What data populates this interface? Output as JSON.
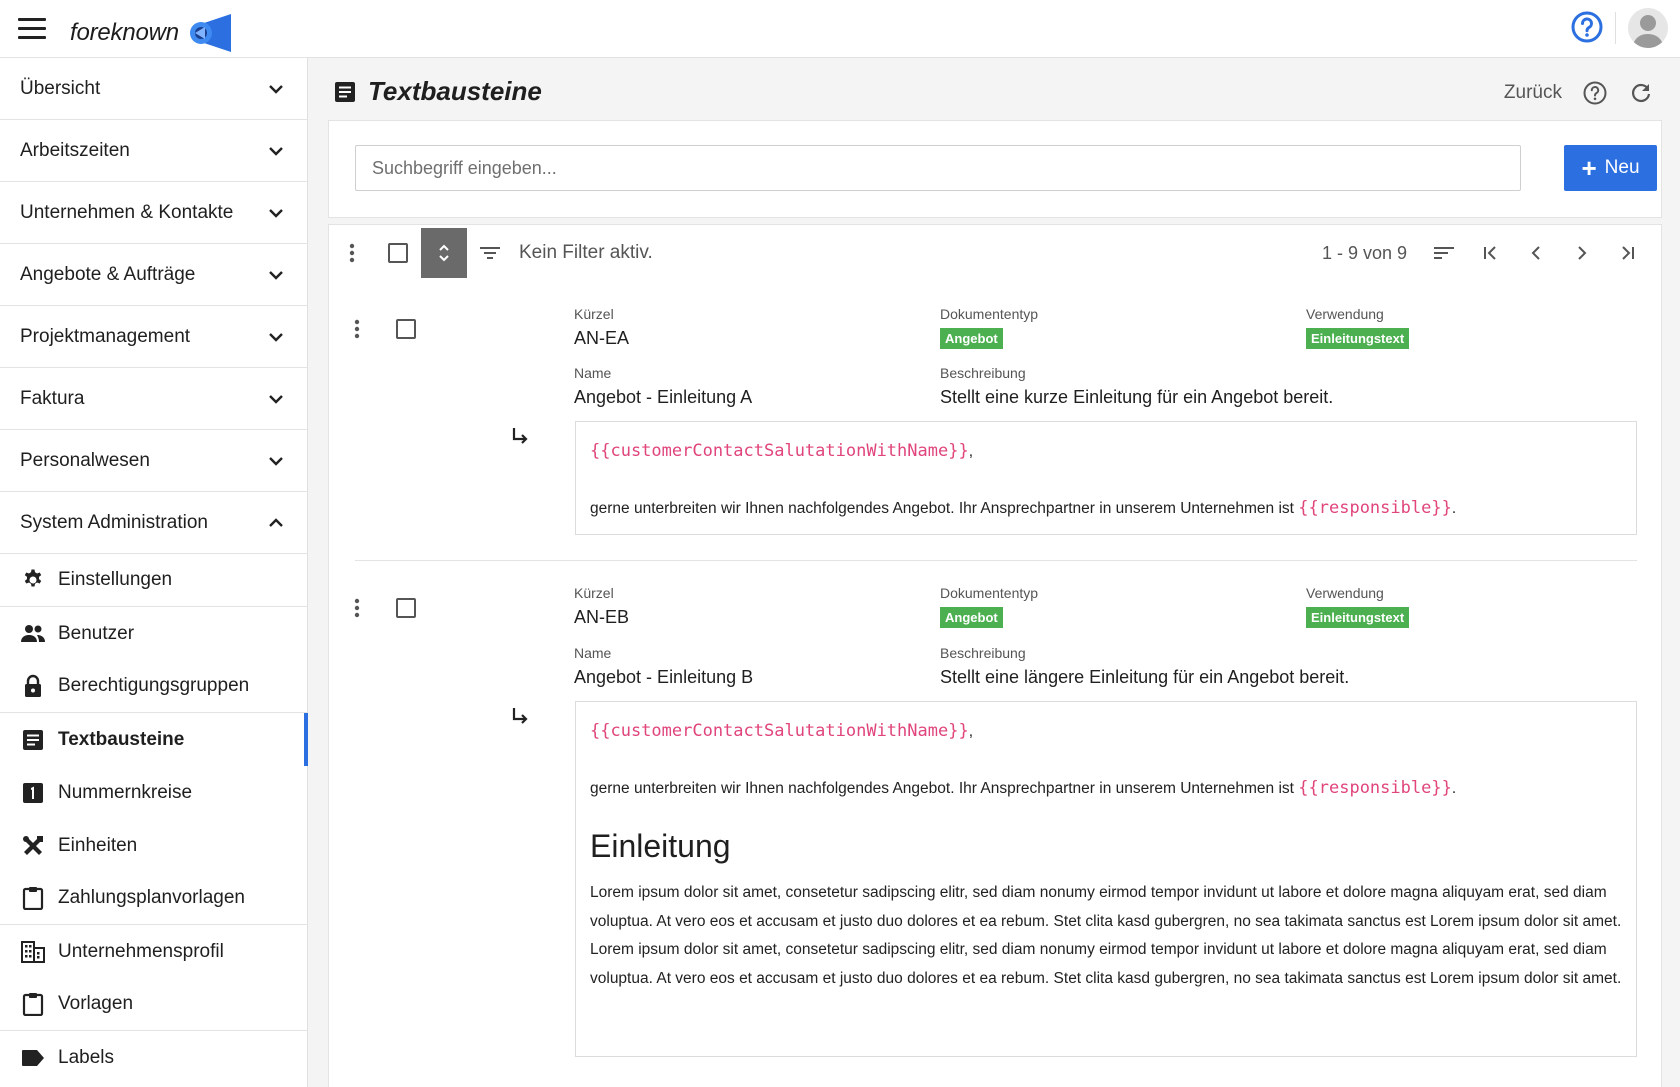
{
  "app": {
    "brand": "foreknown",
    "accent_color": "#2b6fe0",
    "badge_color": "#4caf50",
    "code_color": "#e0457b"
  },
  "sidebar": {
    "sections": [
      {
        "label": "Übersicht",
        "expanded": false
      },
      {
        "label": "Arbeitszeiten",
        "expanded": false
      },
      {
        "label": "Unternehmen & Kontakte",
        "expanded": false
      },
      {
        "label": "Angebote & Aufträge",
        "expanded": false
      },
      {
        "label": "Projektmanagement",
        "expanded": false
      },
      {
        "label": "Faktura",
        "expanded": false
      },
      {
        "label": "Personalwesen",
        "expanded": false
      },
      {
        "label": "System Administration",
        "expanded": true
      }
    ],
    "sub_items": [
      {
        "label": "Einstellungen",
        "icon": "gear-icon"
      },
      {
        "label": "Benutzer",
        "icon": "users-icon"
      },
      {
        "label": "Berechtigungsgruppen",
        "icon": "lock-icon"
      },
      {
        "label": "Textbausteine",
        "icon": "document-icon",
        "active": true
      },
      {
        "label": "Nummernkreise",
        "icon": "number-one-icon"
      },
      {
        "label": "Einheiten",
        "icon": "tools-icon"
      },
      {
        "label": "Zahlungsplanvorlagen",
        "icon": "clipboard-icon"
      },
      {
        "label": "Unternehmensprofil",
        "icon": "building-icon"
      },
      {
        "label": "Vorlagen",
        "icon": "clipboard-icon"
      },
      {
        "label": "Labels",
        "icon": "label-icon"
      }
    ]
  },
  "page": {
    "title": "Textbausteine",
    "back_label": "Zurück"
  },
  "search": {
    "placeholder": "Suchbegriff eingeben...",
    "value": ""
  },
  "new_button": {
    "label": "Neu"
  },
  "toolbar": {
    "filter_text": "Kein Filter aktiv.",
    "pager_text": "1 - 9 von 9"
  },
  "field_labels": {
    "kuerzel": "Kürzel",
    "dokumententyp": "Dokumententyp",
    "verwendung": "Verwendung",
    "name": "Name",
    "beschreibung": "Beschreibung"
  },
  "rows": [
    {
      "kuerzel": "AN-EA",
      "dokumententyp": "Angebot",
      "verwendung": "Einleitungstext",
      "name": "Angebot - Einleitung A",
      "beschreibung": "Stellt eine kurze Einleitung für ein Angebot bereit.",
      "content": {
        "salutation_var": "{{customerContactSalutationWithName}}",
        "salutation_suffix": ",",
        "text_before": "gerne unterbreiten wir Ihnen nachfolgendes Angebot. Ihr Ansprechpartner in unserem Unternehmen ist ",
        "responsible_var": "{{responsible}}",
        "text_after": "."
      }
    },
    {
      "kuerzel": "AN-EB",
      "dokumententyp": "Angebot",
      "verwendung": "Einleitungstext",
      "name": "Angebot - Einleitung B",
      "beschreibung": "Stellt eine längere Einleitung für ein Angebot bereit.",
      "content": {
        "salutation_var": "{{customerContactSalutationWithName}}",
        "salutation_suffix": ",",
        "text_before": "gerne unterbreiten wir Ihnen nachfolgendes Angebot. Ihr Ansprechpartner in unserem Unternehmen ist ",
        "responsible_var": "{{responsible}}",
        "text_after": ".",
        "heading": "Einleitung",
        "lorem": "Lorem ipsum dolor sit amet, consetetur sadipscing elitr, sed diam nonumy eirmod tempor invidunt ut labore et dolore magna aliquyam erat, sed diam voluptua. At vero eos et accusam et justo duo dolores et ea rebum. Stet clita kasd gubergren, no sea takimata sanctus est Lorem ipsum dolor sit amet. Lorem ipsum dolor sit amet, consetetur sadipscing elitr, sed diam nonumy eirmod tempor invidunt ut labore et dolore magna aliquyam erat, sed diam voluptua. At vero eos et accusam et justo duo dolores et ea rebum. Stet clita kasd gubergren, no sea takimata sanctus est Lorem ipsum dolor sit amet."
      }
    }
  ]
}
